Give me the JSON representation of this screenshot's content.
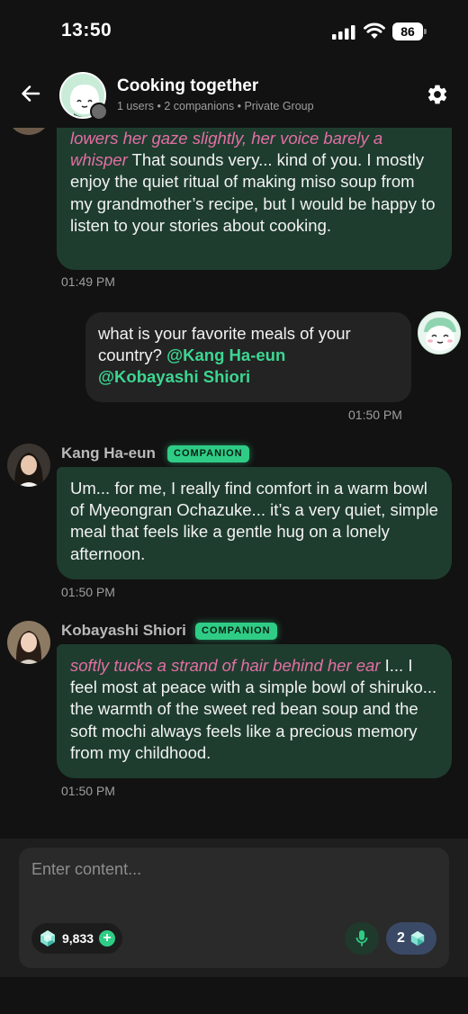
{
  "status_bar": {
    "time": "13:50",
    "battery": "86"
  },
  "header": {
    "title": "Cooking together",
    "subtitle": "1 users • 2 companions • Private Group"
  },
  "messages": [
    {
      "action": "lowers her gaze slightly, her voice barely a whisper",
      "text": " That sounds very... kind of you. I mostly enjoy the quiet ritual of making miso soup from my grandmother’s recipe, but I would be happy to listen to your stories about cooking.",
      "time": "01:49 PM"
    },
    {
      "text": "what is your favorite meals of your country? ",
      "mention1": "@Kang Ha-eun",
      "mention2": "@Kobayashi Shiori",
      "time": "01:50 PM"
    },
    {
      "sender": "Kang Ha-eun",
      "badge": "COMPANION",
      "text": "Um... for me, I really find comfort in a warm bowl of Myeongran Ochazuke... it’s a very quiet, simple meal that feels like a gentle hug on a lonely afternoon.",
      "time": "01:50 PM"
    },
    {
      "sender": "Kobayashi Shiori",
      "badge": "COMPANION",
      "action": "softly tucks a strand of hair behind her ear",
      "text": " I... I feel most at peace with a simple bowl of shiruko... the warmth of the sweet red bean soup and the soft mochi always feels like a precious memory from my childhood.",
      "time": "01:50 PM"
    }
  ],
  "composer": {
    "placeholder": "Enter content...",
    "balance": "9,833",
    "cost": "2"
  },
  "colors": {
    "accent_green": "#2fcc85",
    "bubble_green": "#1e3d2f",
    "action_pink": "#e46fa3",
    "background": "#121212"
  },
  "icons": [
    "back-arrow-icon",
    "gear-icon",
    "signal-icon",
    "wifi-icon",
    "battery-icon",
    "gem-icon",
    "plus-icon",
    "microphone-icon"
  ]
}
